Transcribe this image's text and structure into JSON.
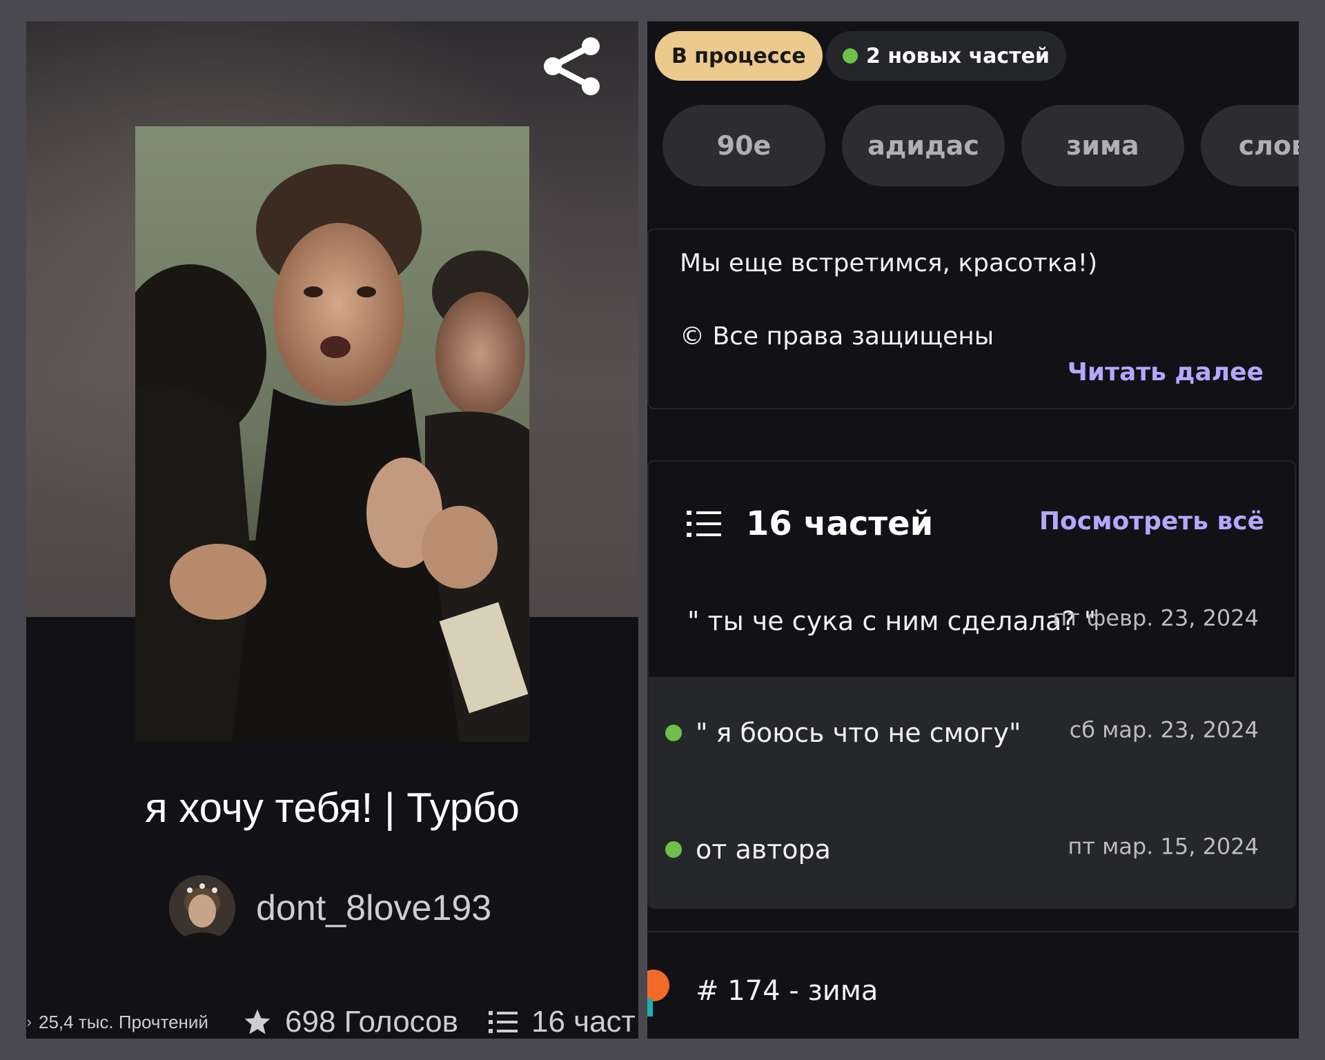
{
  "story": {
    "title": "я хочу тебя! | Турбо",
    "author": "dont_8love193",
    "stats": {
      "reads": "25,4 тыс. Прочтений",
      "votes": "698 Голосов",
      "parts": "16 част"
    }
  },
  "badges": {
    "status": "В процессе",
    "new_parts": "2 новых частей"
  },
  "tags": [
    "90е",
    "адидас",
    "зима",
    "слово"
  ],
  "description": {
    "line1": "Мы еще встретимся, красотка!)",
    "line2": "© Все права защищены",
    "read_more": "Читать далее"
  },
  "parts": {
    "count_label": "16 частей",
    "see_all": "Посмотреть всё",
    "items": [
      {
        "title": "\" ты че сука с ним сделала? \"",
        "date": "пт февр. 23, 2024",
        "new": false
      },
      {
        "title": "\" я боюсь что не смогу\"",
        "date": "сб мар. 23, 2024",
        "new": true
      },
      {
        "title": "от автора",
        "date": "пт мар. 15, 2024",
        "new": true
      }
    ]
  },
  "ranking": {
    "label": "# 174 - зима"
  },
  "colors": {
    "accent": "#b6a6ff",
    "status_badge": "#ecc98d",
    "new_dot": "#6fbf4a",
    "panel_bg": "#121116"
  },
  "icons": [
    "share-icon",
    "star-icon",
    "list-icon",
    "eye-icon",
    "ranking-icon"
  ]
}
